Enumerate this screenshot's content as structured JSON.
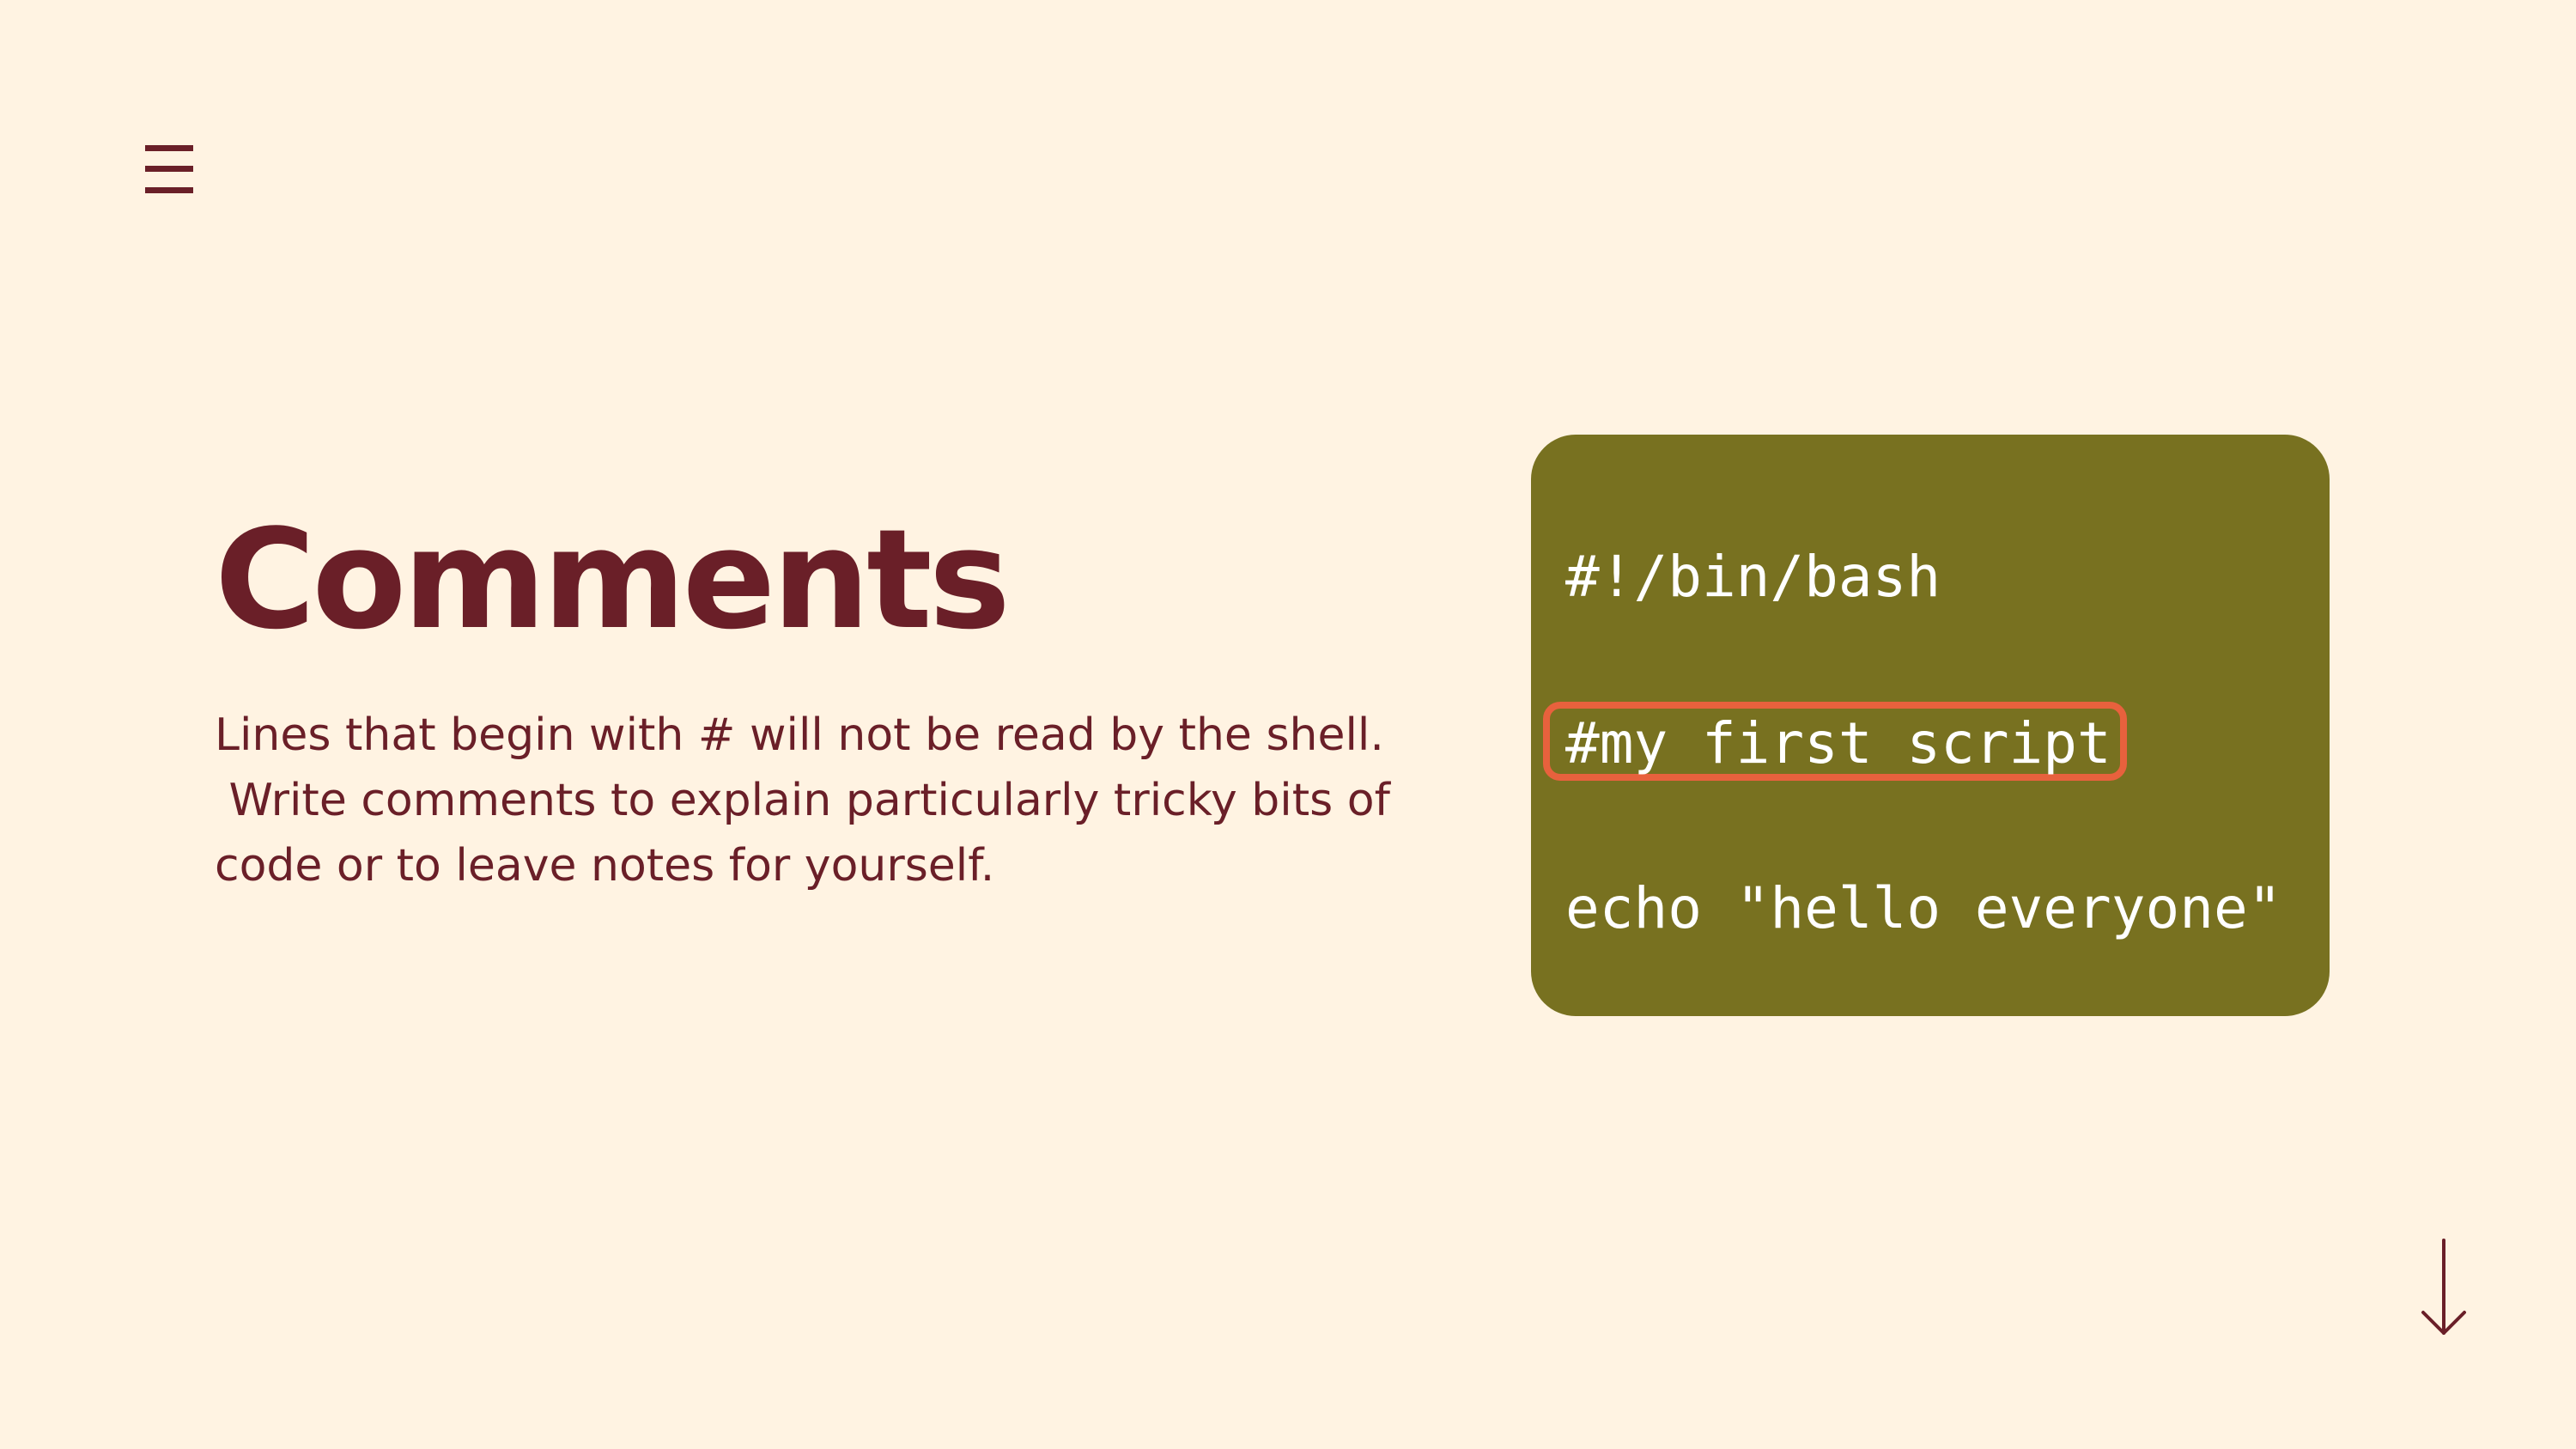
{
  "header": {
    "menu_icon": "hamburger-menu-icon"
  },
  "slide": {
    "title": "Comments",
    "body_lines": [
      "Lines that begin with # will not be read by the shell.",
      " Write comments to explain particularly tricky bits of",
      "code or to leave notes for yourself."
    ]
  },
  "code": {
    "lines": [
      "#!/bin/bash",
      "#my first script",
      "echo \"hello everyone\""
    ],
    "highlighted_line_index": 1
  },
  "footer": {
    "scroll_icon": "arrow-down-icon"
  },
  "colors": {
    "background": "#fff3e2",
    "text": "#6a1f28",
    "code_background": "#787120",
    "code_text": "#ffffff",
    "highlight": "#e8613d"
  }
}
